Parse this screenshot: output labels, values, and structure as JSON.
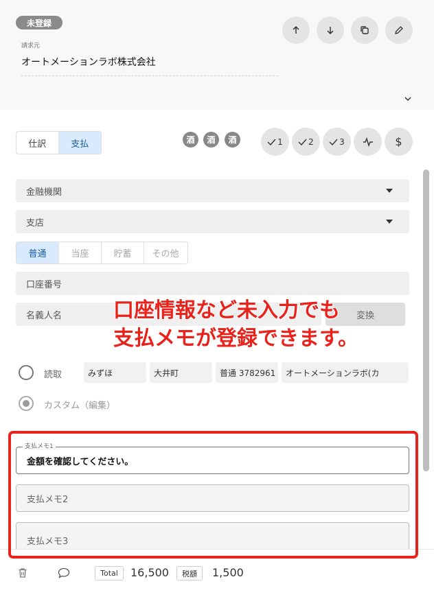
{
  "header": {
    "status_badge": "未登録",
    "billing_label": "請求元",
    "billing_value": "オートメーションラボ株式会社",
    "buttons": [
      "arrow-up-icon",
      "arrow-down-icon",
      "copy-icon",
      "pencil-icon"
    ]
  },
  "tabs": [
    {
      "label": "仕訳",
      "active": false
    },
    {
      "label": "支払",
      "active": true
    }
  ],
  "sake_badges": [
    "酒",
    "酒",
    "酒"
  ],
  "action_buttons": [
    {
      "icon": "check-icon",
      "label": "1"
    },
    {
      "icon": "check-icon",
      "label": "2"
    },
    {
      "icon": "check-icon",
      "label": "3"
    },
    {
      "icon": "activity-icon",
      "label": ""
    },
    {
      "icon": "dollar-icon",
      "label": "$"
    }
  ],
  "form": {
    "bank_placeholder": "金融機関",
    "branch_placeholder": "支店",
    "account_types": [
      {
        "label": "普通",
        "active": true
      },
      {
        "label": "当座",
        "active": false
      },
      {
        "label": "貯蓄",
        "active": false
      },
      {
        "label": "その他",
        "active": false
      }
    ],
    "account_number_placeholder": "口座番号",
    "holder_placeholder": "名義人名",
    "convert_button": "変換",
    "read_label": "読取",
    "read_values": [
      "みずほ",
      "大井町",
      "普通 3782961",
      "オートメーションラボ(カ"
    ],
    "custom_label": "カスタム（編集）"
  },
  "annotation": {
    "line1": "口座情報など未入力でも",
    "line2": "支払メモが登録できます。"
  },
  "memos": {
    "memo1_label": "支払メモ1",
    "memo1_value": "金額を確認してください。",
    "memo2_placeholder": "支払メモ2",
    "memo3_placeholder": "支払メモ3"
  },
  "footer": {
    "total_label": "Total",
    "total_value": "16,500",
    "tax_label": "税額",
    "tax_value": "1,500"
  },
  "colors": {
    "accent_red": "#e8231c",
    "active_tab_bg": "#d8eafb",
    "active_tab_text": "#1a5fa8"
  }
}
